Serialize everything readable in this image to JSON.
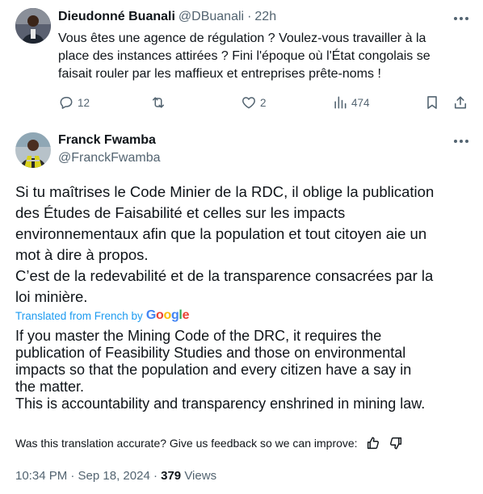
{
  "reply_tweet": {
    "author_name": "Dieudonné Buanali",
    "author_handle": "@DBuanali",
    "separator": "·",
    "time": "22h",
    "text_lines": [
      "Vous êtes une agence de régulation ? Voulez-vous travailler à la",
      "place des instances attirées ? Fini l'époque où l'État congolais se",
      "faisait rouler par les maffieux et entreprises prête-noms !"
    ],
    "actions": {
      "replies": "12",
      "retweets": "",
      "likes": "2",
      "views": "474"
    }
  },
  "main_tweet": {
    "author_name": "Franck Fwamba",
    "author_handle": "@FranckFwamba",
    "original_lines": [
      "Si tu maîtrises le Code Minier de la RDC, il oblige la publication",
      "des Études de Faisabilité et celles sur les impacts",
      "environnementaux afin que la population et tout citoyen aie un",
      "mot à dire à propos.",
      "C’est de la redevabilité et de la transparence consacrées par la",
      "loi minière."
    ],
    "translated_from": "Translated from French by",
    "google": [
      "G",
      "o",
      "o",
      "g",
      "l",
      "e"
    ],
    "google_colors": [
      "#4285F4",
      "#EA4335",
      "#FBBC05",
      "#4285F4",
      "#34A853",
      "#EA4335"
    ],
    "translation_lines": [
      "If you master the Mining Code of the DRC, it requires the",
      "publication of Feasibility Studies and those on environmental",
      "impacts so that the population and every citizen have a say in",
      "the matter.",
      "This is accountability and transparency enshrined in mining law."
    ],
    "feedback_question": "Was this translation accurate? Give us feedback so we can improve:",
    "timestamp": "10:34 PM · Sep 18, 2024 · ",
    "views_count": "379",
    "views_label": " Views"
  },
  "icons": {
    "reply": "speech-bubble-icon",
    "retweet": "retweet-arrows-icon",
    "like": "heart-icon",
    "views": "bar-chart-icon",
    "bookmark": "bookmark-icon",
    "share": "share-upload-icon",
    "more": "ellipsis-icon",
    "thumbs_up": "thumbs-up-icon",
    "thumbs_down": "thumbs-down-icon"
  },
  "colors": {
    "text_primary": "#0f1419",
    "text_secondary": "#536471",
    "link_blue": "#1d9bf0"
  }
}
